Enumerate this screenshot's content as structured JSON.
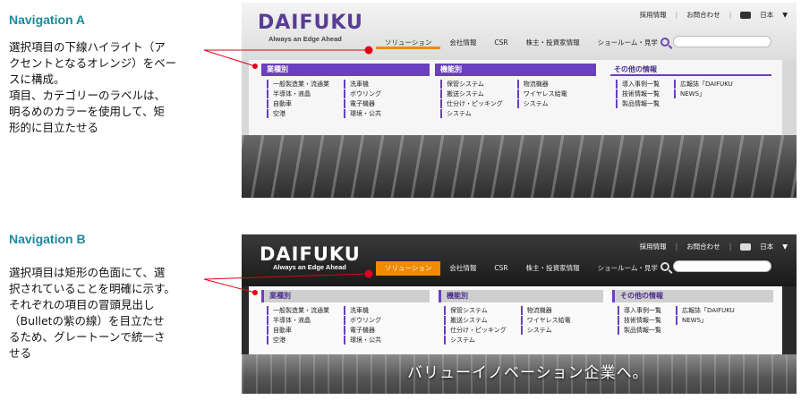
{
  "sectionA": {
    "title": "Navigation A",
    "desc": [
      "選択項目の下線ハイライト（ア",
      "クセントとなるオレンジ）をベー",
      "スに構成。",
      "項目、カテゴリーのラベルは、",
      "明るめのカラーを使用して、矩",
      "形的に目立たせる"
    ]
  },
  "sectionB": {
    "title": "Navigation B",
    "desc": [
      "選択項目は矩形の色面にて、選",
      "択されていることを明確に示す。",
      "それぞれの項目の冒頭見出し",
      "（Bulletの紫の線）を目立たせ",
      "るため、グレートーンで統一さ",
      "せる"
    ]
  },
  "site": {
    "logo": "DAIFUKU",
    "tagline": "Always an Edge Ahead",
    "util": {
      "recruit": "採用情報",
      "contact": "お問合わせ",
      "lang": "日本"
    },
    "nav": [
      "ソリューション",
      "会社情報",
      "CSR",
      "株主・投資家情報",
      "ショールーム・見学"
    ],
    "dropdown": {
      "industry": {
        "head": "業種別",
        "colA": [
          "一般製造業・流通業",
          "半導体・液晶",
          "自動車",
          "空港"
        ],
        "colB": [
          "洗車機",
          "ボウリング",
          "電子機器",
          "環境・公共"
        ]
      },
      "function": {
        "head": "機能別",
        "colA": [
          "保管システム",
          "搬送システム",
          "仕分け・ピッキング",
          "システム"
        ],
        "colB": [
          "物流機器",
          "ワイヤレス給電",
          "システム"
        ]
      },
      "other": {
        "head": "その他の情報",
        "colA": [
          "導入事例一覧",
          "技術情報一覧",
          "製品情報一覧"
        ],
        "colB": [
          "広報誌「DAIFUKU",
          "NEWS」"
        ]
      }
    },
    "caption": "バリューイノベーション企業へ。"
  },
  "colors": {
    "accent": "#f08a00",
    "brand": "#5a3b96",
    "callout": "#e0001a",
    "title": "#1a8aa0"
  }
}
